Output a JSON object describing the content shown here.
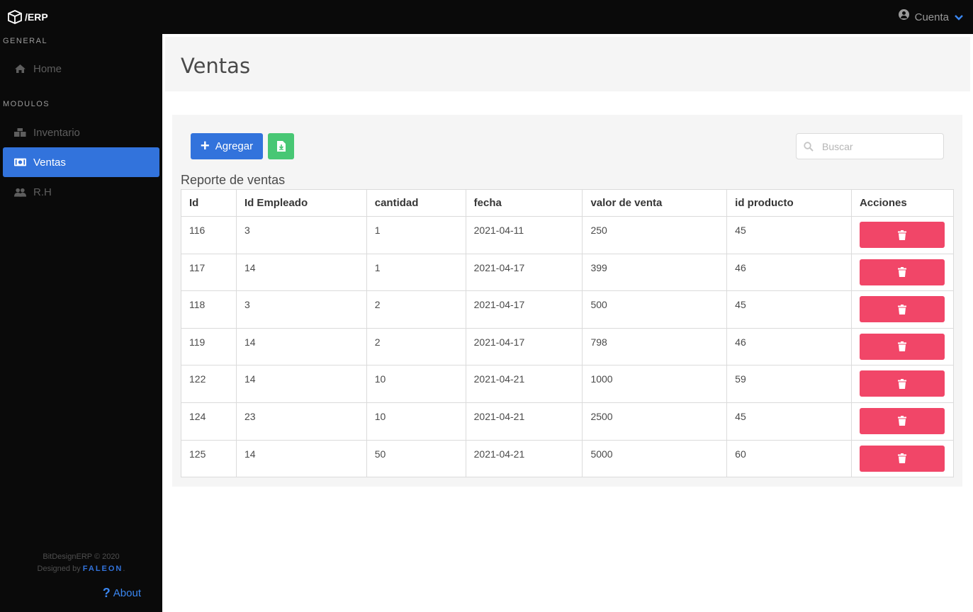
{
  "topbar": {
    "brand": "/ERP",
    "account_label": "Cuenta"
  },
  "sidebar": {
    "sections": [
      {
        "label": "GENERAL"
      },
      {
        "label": "MODULOS"
      }
    ],
    "items": [
      {
        "label": "Home",
        "icon": "home-icon"
      },
      {
        "label": "Inventario",
        "icon": "boxes-icon"
      },
      {
        "label": "Ventas",
        "icon": "money-bill-icon",
        "active": true
      },
      {
        "label": "R.H",
        "icon": "users-icon"
      }
    ],
    "footer_line1": "BitDesignERP © 2020",
    "footer_line2_prefix": "Designed by ",
    "footer_brand": "FALEON",
    "footer_suffix": ".",
    "about_label": "About"
  },
  "page": {
    "title": "Ventas",
    "add_label": "Agregar",
    "search_placeholder": "Buscar",
    "table_caption": "Reporte de ventas"
  },
  "table": {
    "columns": [
      "Id",
      "Id Empleado",
      "cantidad",
      "fecha",
      "valor de venta",
      "id producto",
      "Acciones"
    ],
    "rows": [
      [
        "116",
        "3",
        "1",
        "2021-04-11",
        "250",
        "45"
      ],
      [
        "117",
        "14",
        "1",
        "2021-04-17",
        "399",
        "46"
      ],
      [
        "118",
        "3",
        "2",
        "2021-04-17",
        "500",
        "45"
      ],
      [
        "119",
        "14",
        "2",
        "2021-04-17",
        "798",
        "46"
      ],
      [
        "122",
        "14",
        "10",
        "2021-04-21",
        "1000",
        "59"
      ],
      [
        "124",
        "23",
        "10",
        "2021-04-21",
        "2500",
        "45"
      ],
      [
        "125",
        "14",
        "50",
        "2021-04-21",
        "5000",
        "60"
      ]
    ]
  },
  "colors": {
    "primary": "#3273dc",
    "success": "#48c774",
    "danger": "#f14668",
    "dark": "#0a0a0a"
  }
}
